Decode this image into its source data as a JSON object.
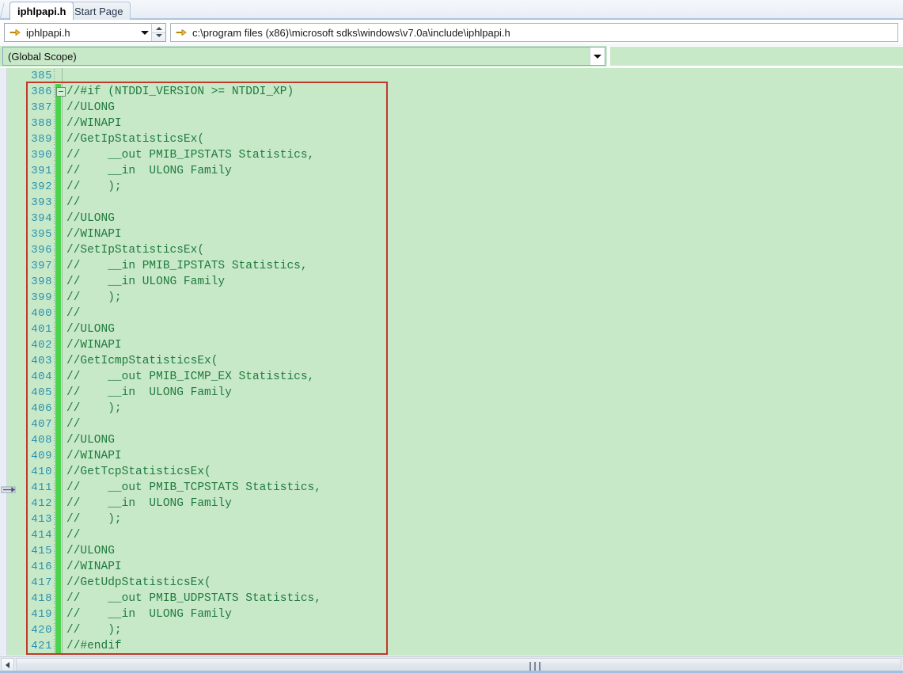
{
  "window": {
    "accent_color": "#c8e9c8",
    "code_color": "#1f7a3d",
    "lineno_color": "#2b91af",
    "annotation_color": "#c0392b",
    "changebar_color": "#4bd44b"
  },
  "tabs": [
    {
      "label": "iphlpapi.h",
      "active": true
    },
    {
      "label": "Start Page",
      "active": false
    }
  ],
  "navbar": {
    "file_combo": {
      "icon": "document-arrow-icon",
      "value": "iphlpapi.h",
      "dropdown_icon": "chevron-down-icon",
      "spinner_icon": "spinner-updown-icon"
    },
    "path_combo": {
      "icon": "document-arrow-icon",
      "value": "c:\\program files (x86)\\microsoft sdks\\windows\\v7.0a\\include\\iphlpapi.h"
    }
  },
  "scopebar": {
    "value": "(Global Scope)",
    "dropdown_icon": "chevron-down-icon"
  },
  "editor": {
    "first_visible_line": 385,
    "outline_marker_line": 386,
    "lines": [
      {
        "no": 385,
        "text": "",
        "changed": false,
        "outline": false
      },
      {
        "no": 386,
        "text": "//#if (NTDDI_VERSION >= NTDDI_XP)",
        "changed": true,
        "outline": true
      },
      {
        "no": 387,
        "text": "//ULONG",
        "changed": true,
        "outline": false
      },
      {
        "no": 388,
        "text": "//WINAPI",
        "changed": true,
        "outline": false
      },
      {
        "no": 389,
        "text": "//GetIpStatisticsEx(",
        "changed": true,
        "outline": false
      },
      {
        "no": 390,
        "text": "//    __out PMIB_IPSTATS Statistics,",
        "changed": true,
        "outline": false
      },
      {
        "no": 391,
        "text": "//    __in  ULONG Family",
        "changed": true,
        "outline": false
      },
      {
        "no": 392,
        "text": "//    );",
        "changed": true,
        "outline": false
      },
      {
        "no": 393,
        "text": "//",
        "changed": true,
        "outline": false
      },
      {
        "no": 394,
        "text": "//ULONG",
        "changed": true,
        "outline": false
      },
      {
        "no": 395,
        "text": "//WINAPI",
        "changed": true,
        "outline": false
      },
      {
        "no": 396,
        "text": "//SetIpStatisticsEx(",
        "changed": true,
        "outline": false
      },
      {
        "no": 397,
        "text": "//    __in PMIB_IPSTATS Statistics,",
        "changed": true,
        "outline": false
      },
      {
        "no": 398,
        "text": "//    __in ULONG Family",
        "changed": true,
        "outline": false
      },
      {
        "no": 399,
        "text": "//    );",
        "changed": true,
        "outline": false
      },
      {
        "no": 400,
        "text": "//",
        "changed": true,
        "outline": false
      },
      {
        "no": 401,
        "text": "//ULONG",
        "changed": true,
        "outline": false
      },
      {
        "no": 402,
        "text": "//WINAPI",
        "changed": true,
        "outline": false
      },
      {
        "no": 403,
        "text": "//GetIcmpStatisticsEx(",
        "changed": true,
        "outline": false
      },
      {
        "no": 404,
        "text": "//    __out PMIB_ICMP_EX Statistics,",
        "changed": true,
        "outline": false
      },
      {
        "no": 405,
        "text": "//    __in  ULONG Family",
        "changed": true,
        "outline": false
      },
      {
        "no": 406,
        "text": "//    );",
        "changed": true,
        "outline": false
      },
      {
        "no": 407,
        "text": "//",
        "changed": true,
        "outline": false
      },
      {
        "no": 408,
        "text": "//ULONG",
        "changed": true,
        "outline": false
      },
      {
        "no": 409,
        "text": "//WINAPI",
        "changed": true,
        "outline": false
      },
      {
        "no": 410,
        "text": "//GetTcpStatisticsEx(",
        "changed": true,
        "outline": false
      },
      {
        "no": 411,
        "text": "//    __out PMIB_TCPSTATS Statistics,",
        "changed": true,
        "outline": false
      },
      {
        "no": 412,
        "text": "//    __in  ULONG Family",
        "changed": true,
        "outline": false
      },
      {
        "no": 413,
        "text": "//    );",
        "changed": true,
        "outline": false
      },
      {
        "no": 414,
        "text": "//",
        "changed": true,
        "outline": false
      },
      {
        "no": 415,
        "text": "//ULONG",
        "changed": true,
        "outline": false
      },
      {
        "no": 416,
        "text": "//WINAPI",
        "changed": true,
        "outline": false
      },
      {
        "no": 417,
        "text": "//GetUdpStatisticsEx(",
        "changed": true,
        "outline": false
      },
      {
        "no": 418,
        "text": "//    __out PMIB_UDPSTATS Statistics,",
        "changed": true,
        "outline": false
      },
      {
        "no": 419,
        "text": "//    __in  ULONG Family",
        "changed": true,
        "outline": false
      },
      {
        "no": 420,
        "text": "//    );",
        "changed": true,
        "outline": false
      },
      {
        "no": 421,
        "text": "//#endif",
        "changed": true,
        "outline": false
      }
    ]
  },
  "scrollbars": {
    "horizontal": {
      "left_arrow_icon": "arrow-left-icon",
      "grip_icon": "grip-icon"
    },
    "splitter_icon": "splitter-handle-icon"
  }
}
